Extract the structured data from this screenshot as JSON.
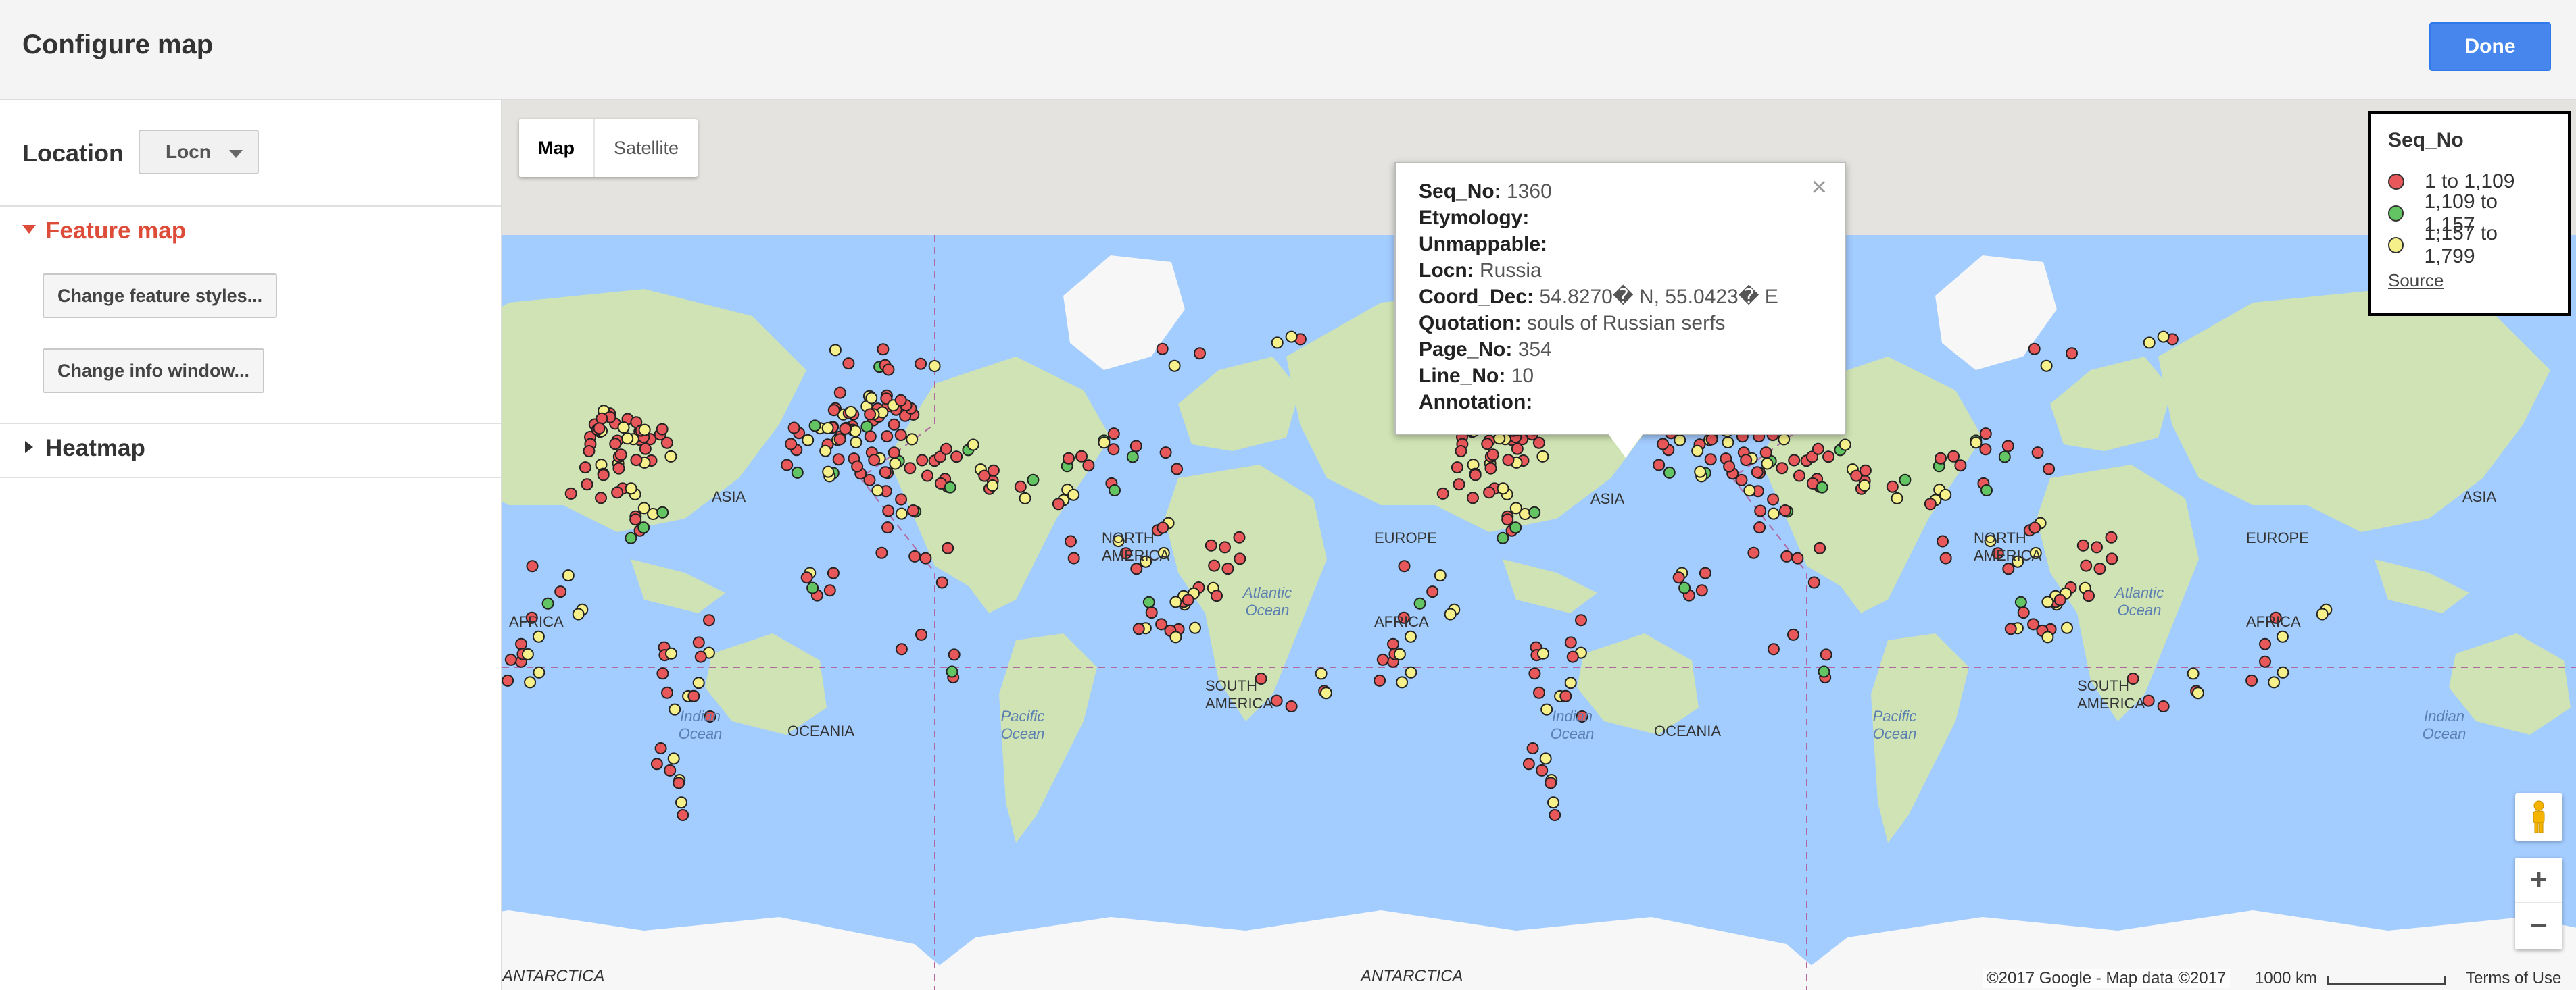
{
  "header": {
    "title": "Configure map",
    "done_label": "Done"
  },
  "sidebar": {
    "location_label": "Location",
    "location_select_value": "Locn",
    "feature_map_label": "Feature map",
    "change_feature_styles_label": "Change feature styles...",
    "change_info_window_label": "Change info window...",
    "heatmap_label": "Heatmap"
  },
  "map": {
    "map_type_buttons": [
      "Map",
      "Satellite"
    ],
    "active_map_type": "Map",
    "continent_labels": [
      "ASIA",
      "EUROPE",
      "AFRICA",
      "NORTH AMERICA",
      "SOUTH AMERICA",
      "OCEANIA",
      "ANTARCTICA"
    ],
    "ocean_labels": [
      "Atlantic Ocean",
      "Indian Ocean",
      "Pacific Ocean"
    ],
    "info_window": {
      "rows": [
        {
          "key": "Seq_No:",
          "value": "1360"
        },
        {
          "key": "Etymology:",
          "value": ""
        },
        {
          "key": "Unmappable:",
          "value": ""
        },
        {
          "key": "Locn:",
          "value": "Russia"
        },
        {
          "key": "Coord_Dec:",
          "value": "54.8270� N, 55.0423� E"
        },
        {
          "key": "Quotation:",
          "value": "souls of Russian serfs"
        },
        {
          "key": "Page_No:",
          "value": "354"
        },
        {
          "key": "Line_No:",
          "value": "10"
        },
        {
          "key": "Annotation:",
          "value": ""
        }
      ],
      "close_glyph": "×"
    },
    "legend": {
      "title": "Seq_No",
      "items": [
        {
          "label": "1 to 1,109",
          "color": "#e8575a"
        },
        {
          "label": "1,109 to 1,157",
          "color": "#62c462"
        },
        {
          "label": "1,157 to 1,799",
          "color": "#f5f08a"
        }
      ],
      "source_label": "Source"
    },
    "zoom_in": "+",
    "zoom_out": "−",
    "pegman_icon": "pegman-icon",
    "attribution": "©2017 Google - Map data ©2017",
    "scale_label": "1000 km",
    "terms_label": "Terms of Use"
  },
  "colors": {
    "accent": "#4787ed",
    "feature_map_heading": "#dd4b39",
    "ocean": "#a3ccff",
    "land": "#cfe3b4",
    "ice": "#f7f7f7"
  }
}
